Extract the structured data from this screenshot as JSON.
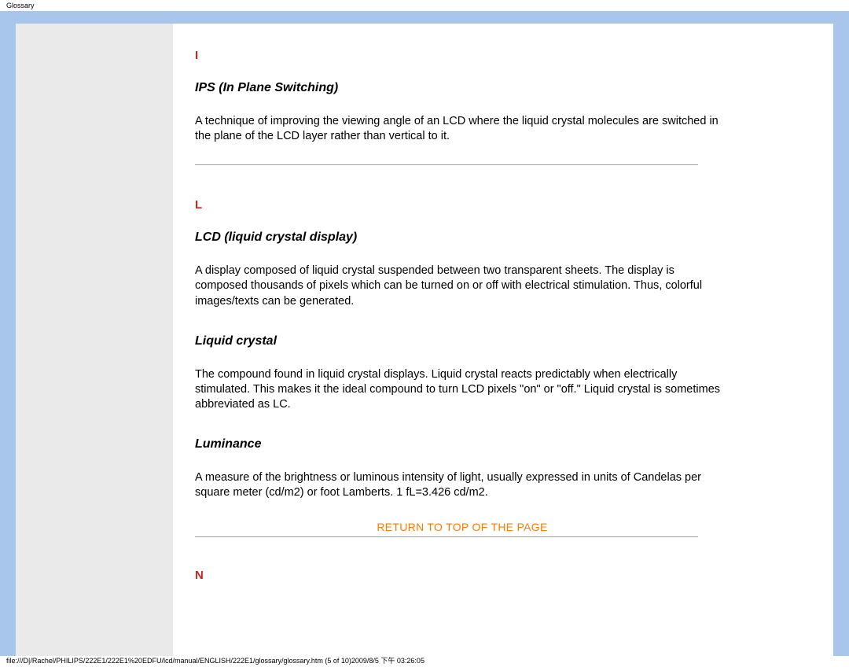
{
  "header": {
    "title": "Glossary"
  },
  "sections": {
    "I": {
      "letter": "I",
      "term1": "IPS (In Plane Switching)",
      "desc1": "A technique of improving the viewing angle of an LCD where the liquid crystal molecules are switched in the plane of the LCD layer rather than vertical to it."
    },
    "L": {
      "letter": "L",
      "term1": "LCD (liquid crystal display)",
      "desc1": "A display composed of liquid crystal suspended between two transparent sheets. The display is composed thousands of pixels which can be turned on or off with electrical stimulation. Thus, colorful images/texts can be generated.",
      "term2": "Liquid crystal",
      "desc2": "The compound found in liquid crystal displays. Liquid crystal reacts predictably when electrically stimulated. This makes it the ideal compound to turn LCD pixels \"on\" or \"off.\" Liquid crystal is sometimes abbreviated as LC.",
      "term3": "Luminance",
      "desc3": "A measure of the brightness or luminous intensity of light, usually expressed in units of Candelas per square meter (cd/m2) or foot Lamberts. 1 fL=3.426 cd/m2."
    },
    "N": {
      "letter": "N"
    }
  },
  "links": {
    "return_top": "RETURN TO TOP OF THE PAGE"
  },
  "footer": {
    "path": "file:///D|/Rachel/PHILIPS/222E1/222E1%20EDFU/lcd/manual/ENGLISH/222E1/glossary/glossary.htm (5 of 10)2009/8/5 下午 03:26:05"
  }
}
